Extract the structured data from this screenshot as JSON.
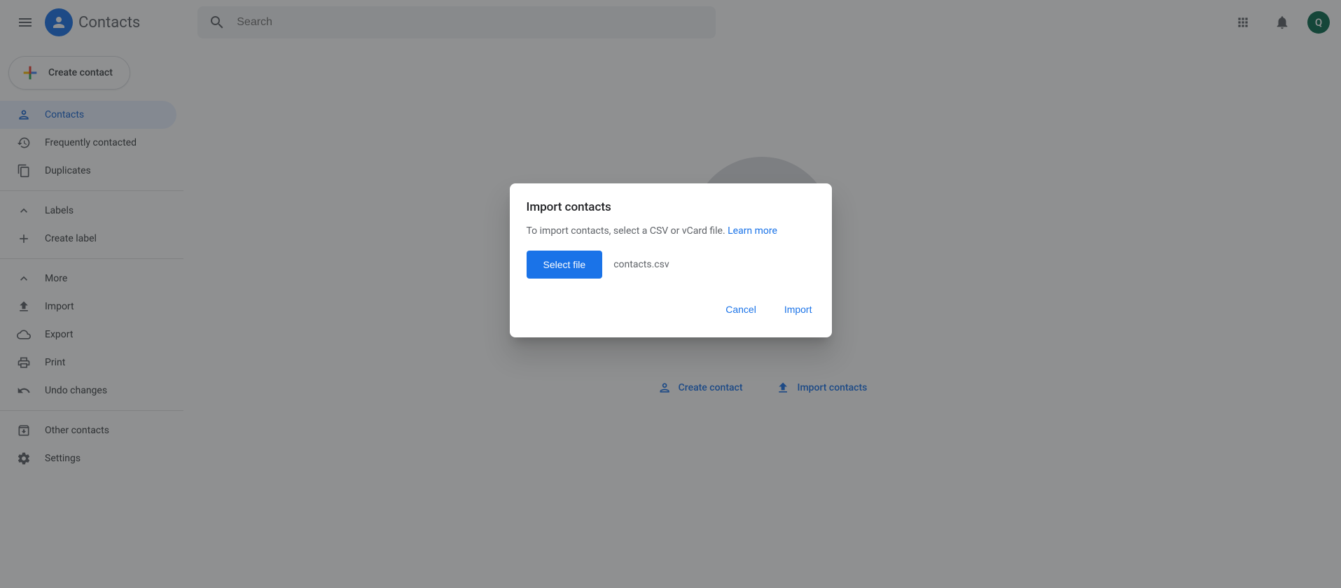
{
  "header": {
    "title": "Contacts",
    "search_placeholder": "Search",
    "avatar_letter": "Q"
  },
  "sidebar": {
    "create_label": "Create contact",
    "items": [
      {
        "label": "Contacts"
      },
      {
        "label": "Frequently contacted"
      },
      {
        "label": "Duplicates"
      }
    ],
    "labels_header": "Labels",
    "create_label_label": "Create label",
    "more_header": "More",
    "more_items": [
      {
        "label": "Import"
      },
      {
        "label": "Export"
      },
      {
        "label": "Print"
      },
      {
        "label": "Undo changes"
      }
    ],
    "other_contacts": "Other contacts",
    "settings": "Settings"
  },
  "main": {
    "create_contact": "Create contact",
    "import_contacts": "Import contacts"
  },
  "dialog": {
    "title": "Import contacts",
    "body_text": "To import contacts, select a CSV or vCard file. ",
    "learn_more": "Learn more",
    "select_file": "Select file",
    "selected_filename": "contacts.csv",
    "cancel": "Cancel",
    "import": "Import"
  }
}
